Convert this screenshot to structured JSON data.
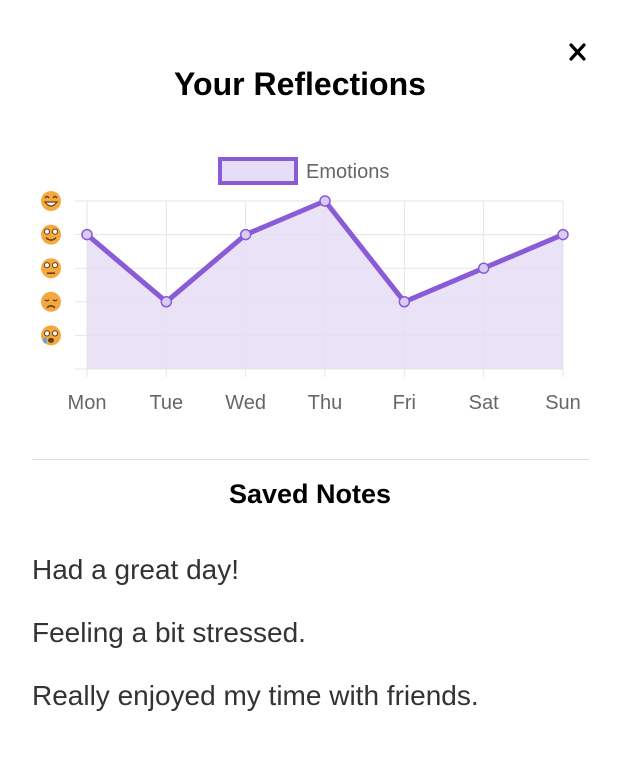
{
  "modal": {
    "title": "Your Reflections",
    "close_label": "close"
  },
  "chart_data": {
    "type": "line",
    "fill": "area",
    "categories": [
      "Mon",
      "Tue",
      "Wed",
      "Thu",
      "Fri",
      "Sat",
      "Sun"
    ],
    "series": [
      {
        "name": "Emotions",
        "values": [
          4,
          2,
          4,
          5,
          2,
          3,
          4
        ]
      }
    ],
    "ylim": [
      0,
      5
    ],
    "y_tick_icons": [
      "grinning-face-icon",
      "smiling-face-icon",
      "neutral-face-icon",
      "sad-face-icon",
      "crying-face-icon"
    ],
    "legend_position": "top-center",
    "grid": true,
    "colors": {
      "line": "#8a5bd6",
      "fill": "#e6ddf6",
      "grid": "#e5e5e5",
      "emoji": "#f4a940"
    }
  },
  "notes": {
    "title": "Saved Notes",
    "items": [
      "Had a great day!",
      "Feeling a bit stressed.",
      "Really enjoyed my time with friends."
    ]
  }
}
